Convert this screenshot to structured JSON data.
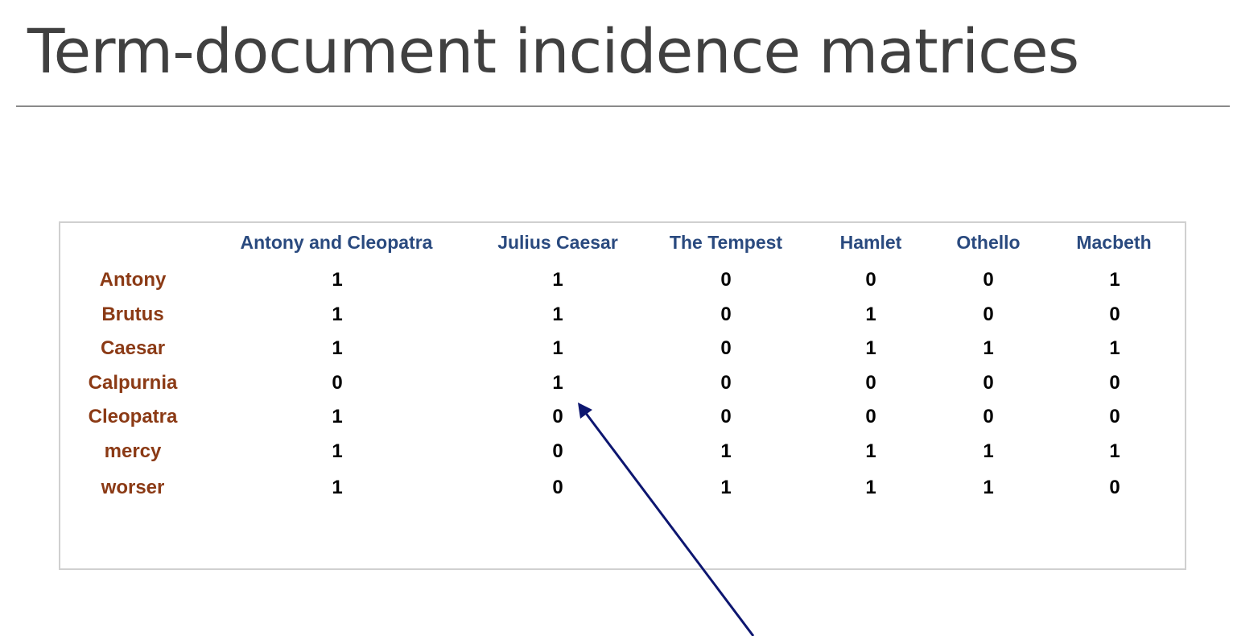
{
  "slide": {
    "title": "Term-document incidence matrices"
  },
  "matrix": {
    "documents": [
      "Antony and Cleopatra",
      "Julius Caesar",
      "The Tempest",
      "Hamlet",
      "Othello",
      "Macbeth"
    ],
    "rows": [
      {
        "term": "Antony",
        "values": [
          "1",
          "1",
          "0",
          "0",
          "0",
          "1"
        ]
      },
      {
        "term": "Brutus",
        "values": [
          "1",
          "1",
          "0",
          "1",
          "0",
          "0"
        ]
      },
      {
        "term": "Caesar",
        "values": [
          "1",
          "1",
          "0",
          "1",
          "1",
          "1"
        ]
      },
      {
        "term": "Calpurnia",
        "values": [
          "0",
          "1",
          "0",
          "0",
          "0",
          "0"
        ]
      },
      {
        "term": "Cleopatra",
        "values": [
          "1",
          "0",
          "0",
          "0",
          "0",
          "0"
        ]
      },
      {
        "term": "mercy",
        "values": [
          "1",
          "0",
          "1",
          "1",
          "1",
          "1"
        ]
      },
      {
        "term": "worser",
        "values": [
          "1",
          "0",
          "1",
          "1",
          "1",
          "0"
        ]
      }
    ]
  },
  "colors": {
    "title": "#404040",
    "document_header": "#2a4a7f",
    "term_label": "#8b3a15",
    "value": "#000000",
    "arrow": "#0d1670"
  }
}
